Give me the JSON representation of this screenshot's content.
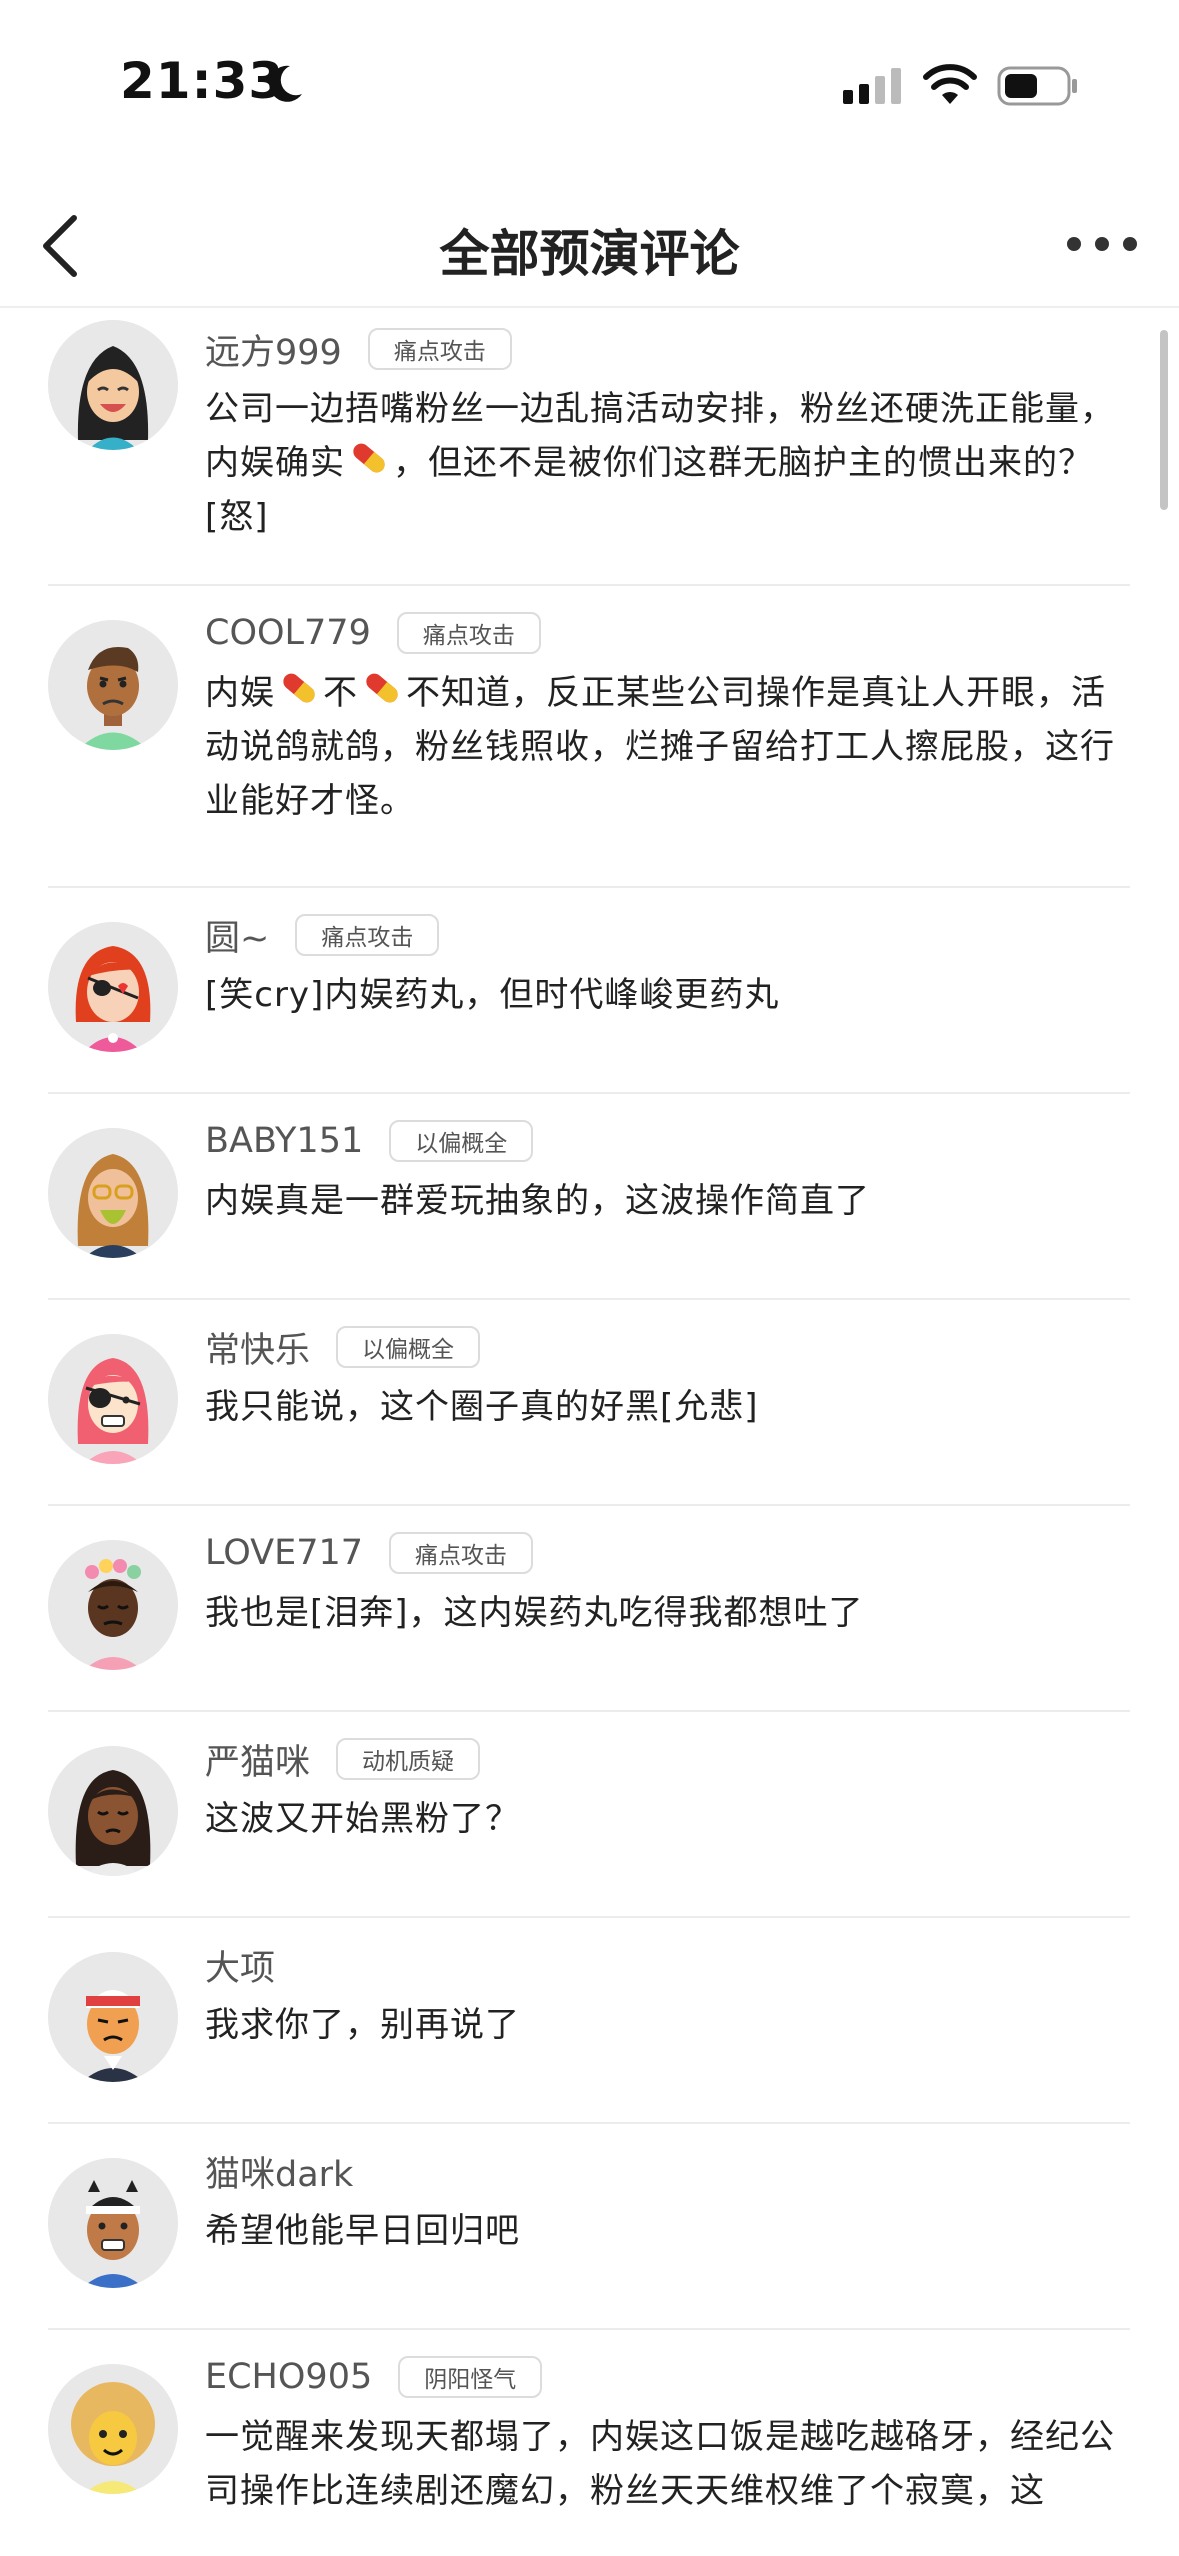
{
  "status_bar": {
    "time": "21:33"
  },
  "nav": {
    "title": "全部预演评论"
  },
  "comments": [
    {
      "username": "远方999",
      "tag": "痛点攻击",
      "text_parts": [
        "公司一边捂嘴粉丝一边乱搞活动安排，粉丝还硬洗正能量，内娱确实",
        "，但还不是被你们这群无脑护主的惯出来的？[怒]"
      ]
    },
    {
      "username": "COOL779",
      "tag": "痛点攻击",
      "text_parts": [
        "内娱",
        "不",
        "不知道，反正某些公司操作是真让人开眼，活动说鸽就鸽，粉丝钱照收，烂摊子留给打工人擦屁股，这行业能好才怪。"
      ]
    },
    {
      "username": "圆~",
      "tag": "痛点攻击",
      "text_parts": [
        "[笑cry]内娱药丸，但时代峰峻更药丸"
      ]
    },
    {
      "username": "BABY151",
      "tag": "以偏概全",
      "text_parts": [
        "内娱真是一群爱玩抽象的，这波操作简直了"
      ]
    },
    {
      "username": "常快乐",
      "tag": "以偏概全",
      "text_parts": [
        "我只能说，这个圈子真的好黑[允悲]"
      ]
    },
    {
      "username": "LOVE717",
      "tag": "痛点攻击",
      "text_parts": [
        "我也是[泪奔]，这内娱药丸吃得我都想吐了"
      ]
    },
    {
      "username": "严猫咪",
      "tag": "动机质疑",
      "text_parts": [
        "这波又开始黑粉了？"
      ]
    },
    {
      "username": "大项",
      "tag": "",
      "text_parts": [
        "我求你了，别再说了"
      ]
    },
    {
      "username": "猫咪dark",
      "tag": "",
      "text_parts": [
        "希望他能早日回归吧"
      ]
    },
    {
      "username": "ECHO905",
      "tag": "阴阳怪气",
      "text_parts": [
        "一觉醒来发现天都塌了，内娱这口饭是越吃越硌牙，经纪公司操作比连续剧还魔幻，粉丝天天维权维了个寂寞，这"
      ]
    }
  ]
}
